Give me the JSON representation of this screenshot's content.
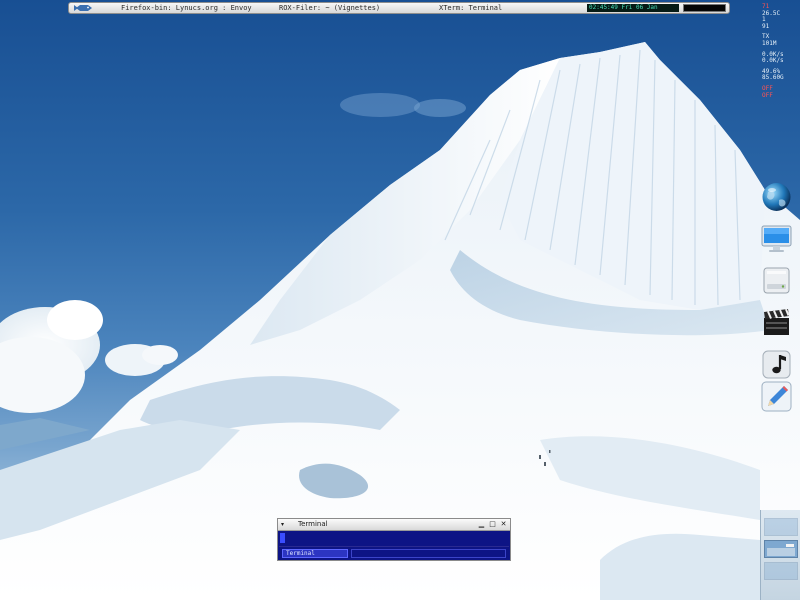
{
  "taskbar": {
    "tasks": [
      {
        "label": "Firefox-bin: Lynucs.org : Envoy"
      },
      {
        "label": "ROX-Filer: ~ (Vignettes)"
      },
      {
        "label": "XTerm: Terminal"
      }
    ],
    "clock": "02:45:49 Fri 06 Jan"
  },
  "system_monitor": {
    "rows": [
      {
        "text": "71",
        "alert": true
      },
      {
        "text": "26.5C",
        "alert": false
      },
      {
        "text": "1",
        "alert": false
      },
      {
        "text": "91",
        "alert": false
      },
      {
        "text": "",
        "alert": false
      },
      {
        "text": "TX",
        "alert": false
      },
      {
        "text": "101M",
        "alert": false
      },
      {
        "text": "",
        "alert": false
      },
      {
        "text": "0.0K/s",
        "alert": false
      },
      {
        "text": "0.0K/s",
        "alert": false
      },
      {
        "text": "",
        "alert": false
      },
      {
        "text": "49.6%",
        "alert": false
      },
      {
        "text": "85.60G",
        "alert": false
      },
      {
        "text": "",
        "alert": false
      },
      {
        "text": "OFF",
        "alert": true
      },
      {
        "text": "OFF",
        "alert": true
      }
    ]
  },
  "dock": {
    "items": [
      {
        "icon": "globe-icon"
      },
      {
        "icon": "monitor-icon"
      },
      {
        "icon": "drive-icon"
      },
      {
        "icon": "clapperboard-icon"
      },
      {
        "icon": "music-note-icon"
      },
      {
        "icon": "pen-icon"
      }
    ]
  },
  "terminal": {
    "title": "Terminal",
    "menu_icon": "▾",
    "buttons": {
      "minimize": "▁",
      "maximize": "□",
      "close": "✕"
    },
    "tab_label": "Terminal"
  },
  "colors": {
    "sky": "#2c68a8",
    "snow": "#f4f8fc",
    "terminal_bg": "#0d1485",
    "clock_text": "#48e0b8",
    "alert": "#ff5353"
  }
}
